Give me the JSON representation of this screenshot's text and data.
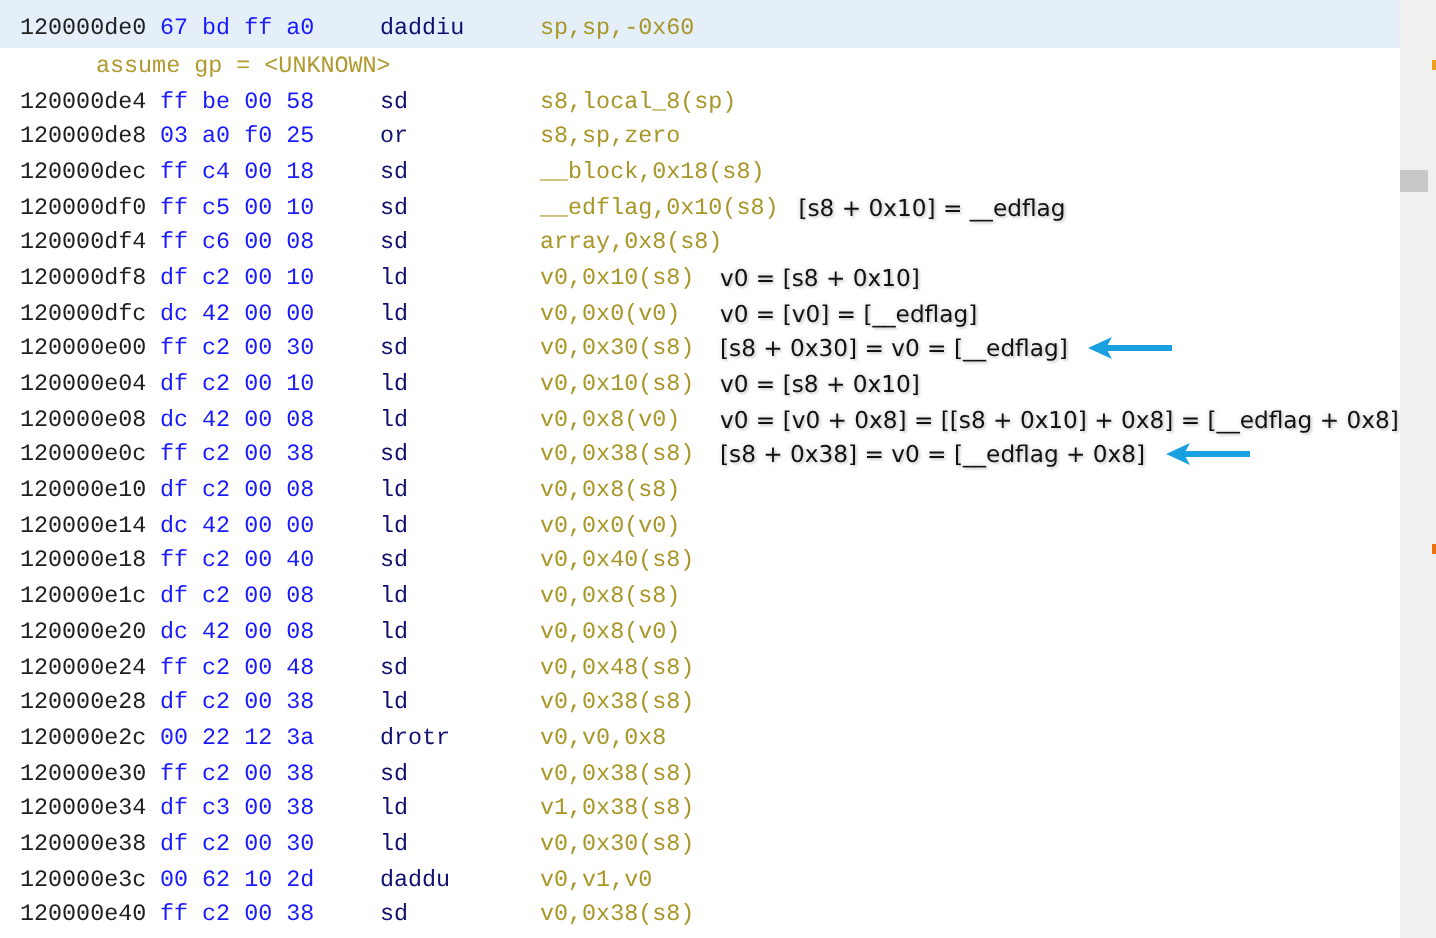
{
  "listing": {
    "rows": [
      {
        "kind": "instruction",
        "selected": true,
        "address": "120000de0",
        "bytes": "67 bd ff a0",
        "mnemonic": "daddiu",
        "operands": "sp,sp,-0x60"
      },
      {
        "kind": "directive",
        "selected": false,
        "text": "assume gp = <UNKNOWN>"
      },
      {
        "kind": "instruction",
        "selected": false,
        "address": "120000de4",
        "bytes": "ff be 00 58",
        "mnemonic": "sd",
        "operands": "s8,local_8(sp)"
      },
      {
        "kind": "instruction",
        "selected": false,
        "address": "120000de8",
        "bytes": "03 a0 f0 25",
        "mnemonic": "or",
        "operands": "s8,sp,zero"
      },
      {
        "kind": "instruction",
        "selected": false,
        "address": "120000dec",
        "bytes": "ff c4 00 18",
        "mnemonic": "sd",
        "operands": "__block,0x18(s8)"
      },
      {
        "kind": "instruction",
        "selected": false,
        "address": "120000df0",
        "bytes": "ff c5 00 10",
        "mnemonic": "sd",
        "operands": "__edflag,0x10(s8)",
        "note": "[s8 + 0x10] = __edflag",
        "arrow": false
      },
      {
        "kind": "instruction",
        "selected": false,
        "address": "120000df4",
        "bytes": "ff c6 00 08",
        "mnemonic": "sd",
        "operands": "array,0x8(s8)"
      },
      {
        "kind": "instruction",
        "selected": false,
        "address": "120000df8",
        "bytes": "df c2 00 10",
        "mnemonic": "ld",
        "operands": "v0,0x10(s8)",
        "note": "v0 = [s8 + 0x10]",
        "arrow": false
      },
      {
        "kind": "instruction",
        "selected": false,
        "address": "120000dfc",
        "bytes": "dc 42 00 00",
        "mnemonic": "ld",
        "operands": "v0,0x0(v0)",
        "note": "v0 = [v0] = [__edflag]",
        "arrow": false
      },
      {
        "kind": "instruction",
        "selected": false,
        "address": "120000e00",
        "bytes": "ff c2 00 30",
        "mnemonic": "sd",
        "operands": "v0,0x30(s8)",
        "note": "[s8 + 0x30] = v0 = [__edflag]",
        "arrow": true
      },
      {
        "kind": "instruction",
        "selected": false,
        "address": "120000e04",
        "bytes": "df c2 00 10",
        "mnemonic": "ld",
        "operands": "v0,0x10(s8)",
        "note": "v0 = [s8 + 0x10]",
        "arrow": false
      },
      {
        "kind": "instruction",
        "selected": false,
        "address": "120000e08",
        "bytes": "dc 42 00 08",
        "mnemonic": "ld",
        "operands": "v0,0x8(v0)",
        "note": "v0 = [v0 + 0x8] = [[s8 + 0x10] + 0x8] = [__edflag + 0x8]",
        "arrow": false
      },
      {
        "kind": "instruction",
        "selected": false,
        "address": "120000e0c",
        "bytes": "ff c2 00 38",
        "mnemonic": "sd",
        "operands": "v0,0x38(s8)",
        "note": "[s8 + 0x38] = v0 = [__edflag + 0x8]",
        "arrow": true
      },
      {
        "kind": "instruction",
        "selected": false,
        "address": "120000e10",
        "bytes": "df c2 00 08",
        "mnemonic": "ld",
        "operands": "v0,0x8(s8)"
      },
      {
        "kind": "instruction",
        "selected": false,
        "address": "120000e14",
        "bytes": "dc 42 00 00",
        "mnemonic": "ld",
        "operands": "v0,0x0(v0)"
      },
      {
        "kind": "instruction",
        "selected": false,
        "address": "120000e18",
        "bytes": "ff c2 00 40",
        "mnemonic": "sd",
        "operands": "v0,0x40(s8)"
      },
      {
        "kind": "instruction",
        "selected": false,
        "address": "120000e1c",
        "bytes": "df c2 00 08",
        "mnemonic": "ld",
        "operands": "v0,0x8(s8)"
      },
      {
        "kind": "instruction",
        "selected": false,
        "address": "120000e20",
        "bytes": "dc 42 00 08",
        "mnemonic": "ld",
        "operands": "v0,0x8(v0)"
      },
      {
        "kind": "instruction",
        "selected": false,
        "address": "120000e24",
        "bytes": "ff c2 00 48",
        "mnemonic": "sd",
        "operands": "v0,0x48(s8)"
      },
      {
        "kind": "instruction",
        "selected": false,
        "address": "120000e28",
        "bytes": "df c2 00 38",
        "mnemonic": "ld",
        "operands": "v0,0x38(s8)"
      },
      {
        "kind": "instruction",
        "selected": false,
        "address": "120000e2c",
        "bytes": "00 22 12 3a",
        "mnemonic": "drotr",
        "operands": "v0,v0,0x8"
      },
      {
        "kind": "instruction",
        "selected": false,
        "address": "120000e30",
        "bytes": "ff c2 00 38",
        "mnemonic": "sd",
        "operands": "v0,0x38(s8)"
      },
      {
        "kind": "instruction",
        "selected": false,
        "address": "120000e34",
        "bytes": "df c3 00 38",
        "mnemonic": "ld",
        "operands": "v1,0x38(s8)"
      },
      {
        "kind": "instruction",
        "selected": false,
        "address": "120000e38",
        "bytes": "df c2 00 30",
        "mnemonic": "ld",
        "operands": "v0,0x30(s8)"
      },
      {
        "kind": "instruction",
        "selected": false,
        "address": "120000e3c",
        "bytes": "00 62 10 2d",
        "mnemonic": "daddu",
        "operands": "v0,v1,v0"
      },
      {
        "kind": "instruction",
        "selected": false,
        "address": "120000e40",
        "bytes": "ff c2 00 38",
        "mnemonic": "sd",
        "operands": "v0,0x38(s8)"
      }
    ]
  }
}
